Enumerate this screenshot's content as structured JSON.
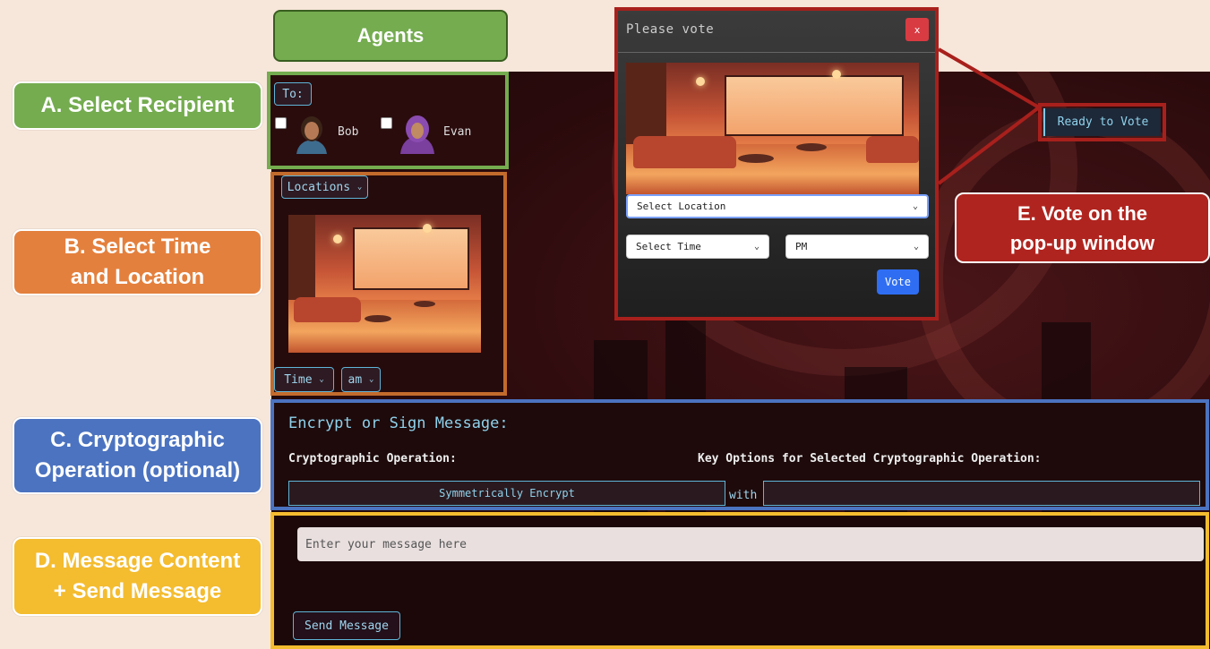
{
  "labels": {
    "a": "A. Select Recipient",
    "b_line1": "B. Select Time",
    "b_line2": "and Location",
    "c_line1": "C. Cryptographic",
    "c_line2": "Operation (optional)",
    "d_line1": "D. Message Content",
    "d_line2": "+ Send Message",
    "e_line1": "E. Vote on the",
    "e_line2": "pop-up window"
  },
  "agents_header": "Agents",
  "recipient": {
    "to_label": "To:",
    "agents": [
      {
        "name": "Bob",
        "checked": false
      },
      {
        "name": "Evan",
        "checked": false
      }
    ]
  },
  "time_location": {
    "locations_label": "Locations",
    "time_label": "Time",
    "ampm_label": "am"
  },
  "crypto": {
    "title": "Encrypt or Sign Message:",
    "operation_label": "Cryptographic Operation:",
    "key_options_label": "Key Options for Selected Cryptographic Operation:",
    "selected_operation": "Symmetrically Encrypt",
    "with_label": "with",
    "selected_key": ""
  },
  "message": {
    "placeholder": "Enter your message here",
    "value": "",
    "send_label": "Send Message"
  },
  "ready_to_vote_label": "Ready to Vote",
  "popup": {
    "title": "Please vote",
    "close_label": "x",
    "location_select": "Select Location",
    "time_select": "Select Time",
    "ampm_select": "PM",
    "vote_label": "Vote"
  },
  "colors": {
    "green": "#74ac4f",
    "orange": "#e4803d",
    "blue": "#4b73c0",
    "yellow": "#f4bc2f",
    "red": "#b0241f",
    "vote_button": "#2f6ef3",
    "close_button": "#d93b42"
  }
}
